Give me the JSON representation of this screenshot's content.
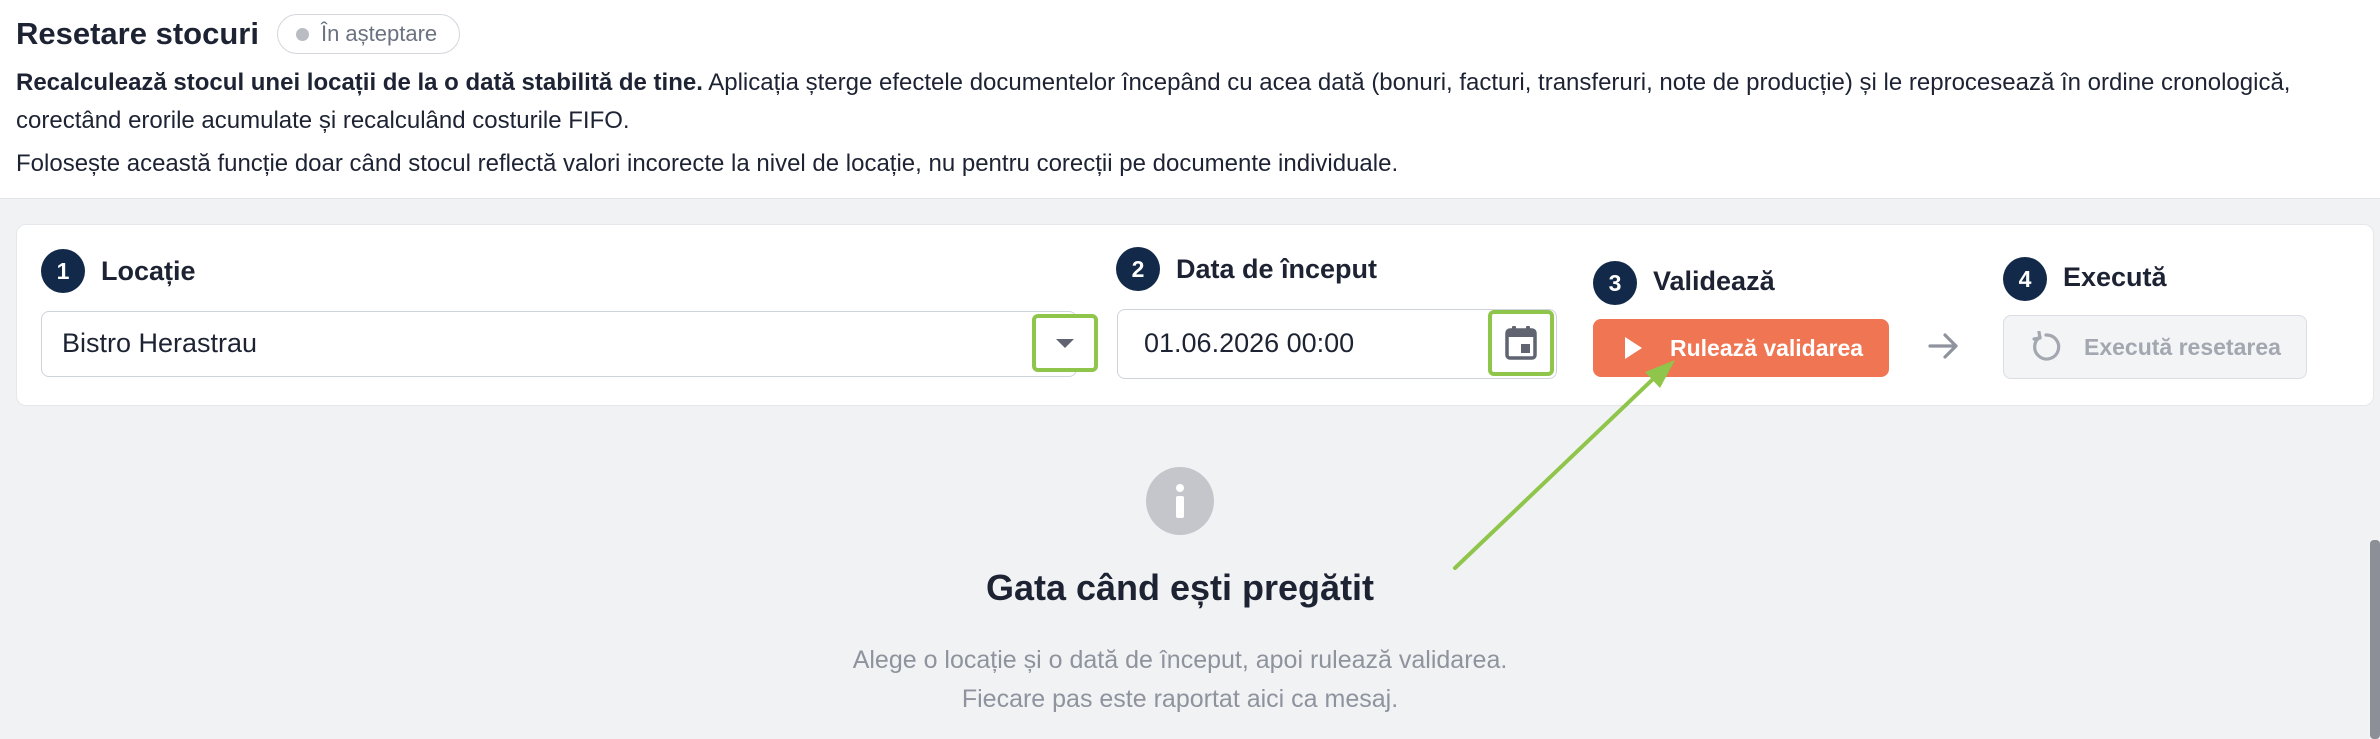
{
  "header": {
    "title": "Resetare stocuri",
    "status": "În așteptare",
    "description_bold": "Recalculează stocul unei locații de la o dată stabilită de tine.",
    "description_rest": " Aplicația șterge efectele documentelor începând cu acea dată (bonuri, facturi, transferuri, note de producție) și le reprocesează în ordine cronologică, corectând erorile acumulate și recalculând costurile FIFO.",
    "note": "Folosește această funcție doar când stocul reflectă valori incorecte la nivel de locație, nu pentru corecții pe documente individuale."
  },
  "steps": [
    {
      "number": "1",
      "label": "Locație"
    },
    {
      "number": "2",
      "label": "Data de început"
    },
    {
      "number": "3",
      "label": "Validează"
    },
    {
      "number": "4",
      "label": "Execută"
    }
  ],
  "location_select": {
    "value": "Bistro Herastrau"
  },
  "date_input": {
    "value": "01.06.2026 00:00"
  },
  "buttons": {
    "run_validation": "Rulează validarea",
    "execute_reset": "Execută resetarea"
  },
  "empty_state": {
    "title": "Gata când ești pregătit",
    "text": "Alege o locație și o dată de început, apoi rulează validarea. Fiecare pas este raportat aici ca mesaj."
  },
  "colors": {
    "accent": "#f07552",
    "step_badge": "#12294a",
    "highlight": "#8fc54a"
  },
  "icons": [
    "chevron-down-icon",
    "calendar-icon",
    "play-icon",
    "arrow-right-icon",
    "reset-icon",
    "info-icon"
  ]
}
